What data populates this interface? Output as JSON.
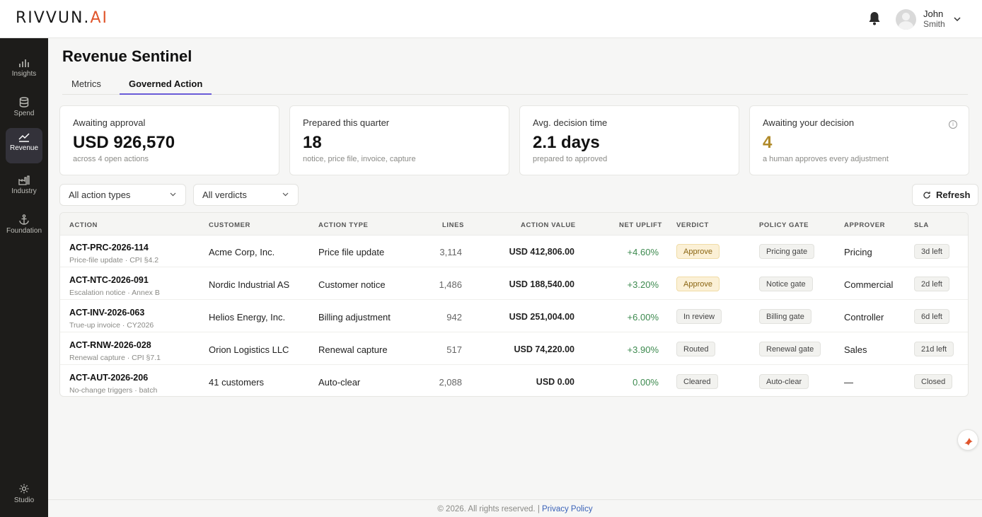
{
  "brand": {
    "name": "RIVVUN.",
    "suffix": "AI"
  },
  "user": {
    "first": "John",
    "last": "Smith"
  },
  "sidebar": {
    "items": [
      {
        "label": "Insights",
        "icon": "bar-chart-icon"
      },
      {
        "label": "Spend",
        "icon": "database-icon"
      },
      {
        "label": "Revenue",
        "icon": "trend-up-icon"
      },
      {
        "label": "Industry",
        "icon": "factory-icon"
      },
      {
        "label": "Foundation",
        "icon": "anchor-icon"
      }
    ],
    "studio": "Studio"
  },
  "page": {
    "title": "Revenue Sentinel",
    "tabs": [
      "Metrics",
      "Governed Action"
    ],
    "active_tab": "Governed Action"
  },
  "cards": [
    {
      "label": "Awaiting approval",
      "value": "USD 926,570",
      "sub": "across 4 open actions"
    },
    {
      "label": "Prepared this quarter",
      "value": "18",
      "sub": "notice, price file, invoice, capture"
    },
    {
      "label": "Avg. decision time",
      "value": "2.1 days",
      "sub": "prepared to approved"
    },
    {
      "label": "Awaiting your decision",
      "value": "4",
      "sub": "a human approves every adjustment",
      "accent": "#b08a2a"
    }
  ],
  "filters": {
    "action_types": "All action types",
    "verdicts": "All verdicts",
    "refresh": "Refresh"
  },
  "table": {
    "headers": [
      "ACTION",
      "CUSTOMER",
      "ACTION TYPE",
      "LINES",
      "ACTION VALUE",
      "NET UPLIFT",
      "VERDICT",
      "POLICY GATE",
      "APPROVER",
      "SLA"
    ],
    "rows": [
      {
        "id": "ACT-PRC-2026-114",
        "sub": "Price-file update · CPI §4.2",
        "customer": "Acme Corp, Inc.",
        "type": "Price file update",
        "lines": "3,114",
        "value": "USD 412,806.00",
        "uplift": "+4.60%",
        "verdict": "Approve",
        "gate": "Pricing gate",
        "approver": "Pricing",
        "sla": "3d left"
      },
      {
        "id": "ACT-NTC-2026-091",
        "sub": "Escalation notice · Annex B",
        "customer": "Nordic Industrial AS",
        "type": "Customer notice",
        "lines": "1,486",
        "value": "USD 188,540.00",
        "uplift": "+3.20%",
        "verdict": "Approve",
        "gate": "Notice gate",
        "approver": "Commercial",
        "sla": "2d left"
      },
      {
        "id": "ACT-INV-2026-063",
        "sub": "True-up invoice · CY2026",
        "customer": "Helios Energy, Inc.",
        "type": "Billing adjustment",
        "lines": "942",
        "value": "USD 251,004.00",
        "uplift": "+6.00%",
        "verdict": "In review",
        "gate": "Billing gate",
        "approver": "Controller",
        "sla": "6d left"
      },
      {
        "id": "ACT-RNW-2026-028",
        "sub": "Renewal capture · CPI §7.1",
        "customer": "Orion Logistics LLC",
        "type": "Renewal capture",
        "lines": "517",
        "value": "USD 74,220.00",
        "uplift": "+3.90%",
        "verdict": "Routed",
        "gate": "Renewal gate",
        "approver": "Sales",
        "sla": "21d left"
      },
      {
        "id": "ACT-AUT-2026-206",
        "sub": "No-change triggers · batch",
        "customer": "41 customers",
        "type": "Auto-clear",
        "lines": "2,088",
        "value": "USD 0.00",
        "uplift": "0.00%",
        "verdict": "Cleared",
        "gate": "Auto-clear",
        "approver": "—",
        "sla": "Closed"
      }
    ]
  },
  "footer": {
    "text": "© 2026. All rights reserved. |",
    "link": "Privacy Policy"
  }
}
